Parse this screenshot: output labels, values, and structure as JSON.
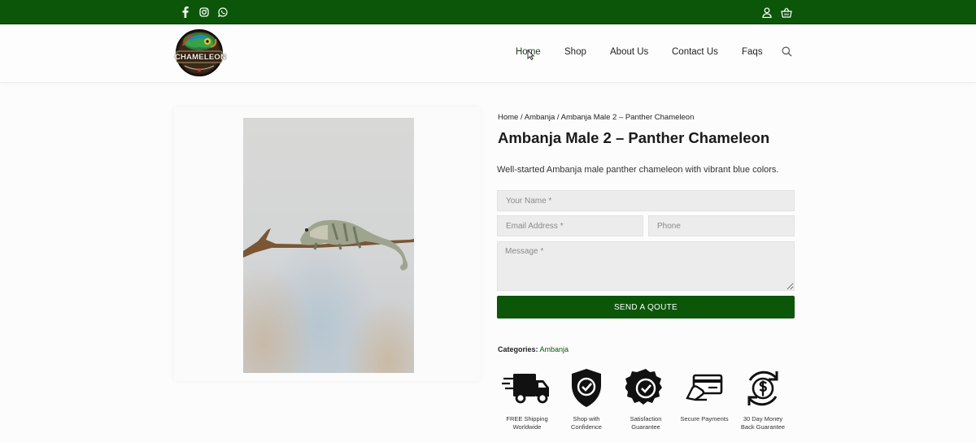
{
  "topbar": {
    "background": "#0b5608",
    "social_icons": [
      "facebook-icon",
      "instagram-icon",
      "whatsapp-icon"
    ],
    "account_icons": [
      "user-icon",
      "shopping-basket-icon"
    ]
  },
  "header": {
    "logo_text": "CHAMELEON",
    "nav": [
      "Home",
      "Shop",
      "About Us",
      "Contact Us",
      "Faqs"
    ],
    "active_nav": "Home",
    "search_icon": "search-icon"
  },
  "product": {
    "breadcrumb": {
      "home": "Home",
      "category": "Ambanja",
      "current": "Ambanja Male 2 – Panther Chameleon",
      "separator": " / "
    },
    "title": "Ambanja Male 2 – Panther Chameleon",
    "description": "Well-started Ambanja male panther chameleon with vibrant blue colors.",
    "image_alt": "Ambanja male panther chameleon on a branch"
  },
  "form": {
    "name_placeholder": "Your Name *",
    "email_placeholder": "Email Address *",
    "phone_placeholder": "Phone",
    "message_placeholder": "Message *",
    "submit_label": "SEND A QOUTE",
    "accent": "#0b5608"
  },
  "meta": {
    "categories_label": "Categories:",
    "category": "Ambanja"
  },
  "badges": [
    {
      "icon": "delivery-truck-icon",
      "line1": "FREE Shipping",
      "line2": "Worldwide"
    },
    {
      "icon": "shield-check-icon",
      "line1": "Shop with",
      "line2": "Confidence"
    },
    {
      "icon": "guarantee-seal-icon",
      "line1": "Satisfaction",
      "line2": "Guarantee"
    },
    {
      "icon": "credit-card-icon",
      "line1": "Secure Payments",
      "line2": ""
    },
    {
      "icon": "money-back-icon",
      "line1": "30 Day Money",
      "line2": "Back Guarantee"
    }
  ]
}
